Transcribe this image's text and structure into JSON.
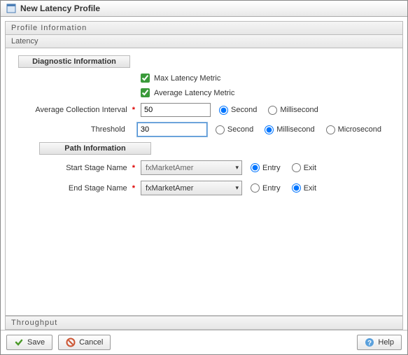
{
  "window": {
    "title": "New Latency Profile"
  },
  "sections": {
    "profile_info": "Profile Information",
    "latency": "Latency",
    "throughput": "Throughput"
  },
  "groups": {
    "diagnostic": "Diagnostic Information",
    "path": "Path Information"
  },
  "labels": {
    "max_latency": "Max Latency Metric",
    "avg_latency": "Average Latency Metric",
    "avg_interval": "Average Collection Interval",
    "threshold": "Threshold",
    "start_stage": "Start Stage Name",
    "end_stage": "End Stage Name",
    "second": "Second",
    "millisecond": "Millisecond",
    "microsecond": "Microsecond",
    "entry": "Entry",
    "exit": "Exit"
  },
  "values": {
    "avg_interval": "50",
    "threshold": "30",
    "start_stage": "fxMarketAmer",
    "end_stage": "fxMarketAmer"
  },
  "checks": {
    "max_latency": true,
    "avg_latency": true
  },
  "radios": {
    "interval_unit": "Second",
    "threshold_unit": "Millisecond",
    "start_type": "Entry",
    "end_type": "Exit"
  },
  "buttons": {
    "save": "Save",
    "cancel": "Cancel",
    "help": "Help"
  }
}
